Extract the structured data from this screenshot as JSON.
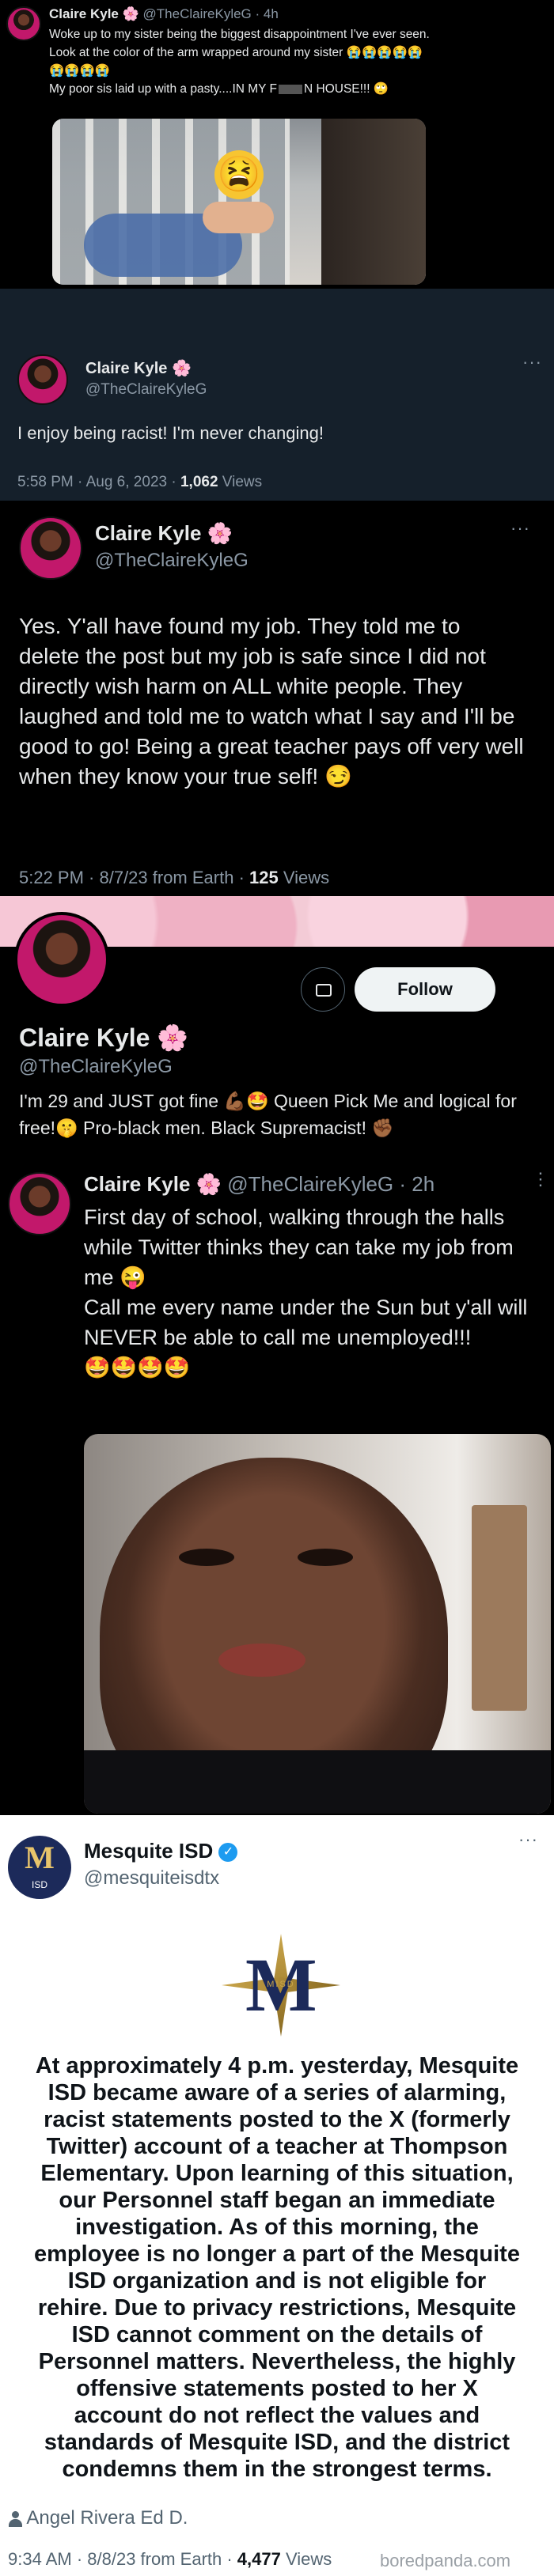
{
  "tweet1": {
    "name": "Claire Kyle",
    "name_emoji": "🌸",
    "handle": "@TheClaireKyleG",
    "time": "· 4h",
    "line1": "Woke up to my sister being the biggest disappointment I've ever seen.",
    "line2": "Look at the color of the arm wrapped around my sister",
    "line3_emojis": "😭😭😭😭😭",
    "line4_emojis": "😭😭😭😭",
    "line5": "My poor sis laid up with a pasty....IN MY F",
    "line5_end": "N HOUSE!!! 🙄",
    "photo_sticker": "😫"
  },
  "tweet2": {
    "name": "Claire Kyle",
    "name_emoji": "🌸",
    "handle": "@TheClaireKyleG",
    "text": "I enjoy being racist! I'm never changing!",
    "timestamp": "5:58 PM · Aug 6, 2023 · ",
    "views_count": "1,062",
    "views_label": " Views"
  },
  "tweet3": {
    "name": "Claire Kyle",
    "name_emoji": "🌸",
    "handle": "@TheClaireKyleG",
    "text": "Yes. Y'all have found my job. They told me to delete the post but my job is safe since I did not directly wish harm on ALL white people. They laughed and told me to watch what I say and I'll be good to go! Being a great teacher pays off very well when they know your true self! 😏",
    "timestamp": "5:22 PM · 8/7/23 from Earth · ",
    "views_count": "125",
    "views_label": " Views"
  },
  "profile": {
    "name": "Claire Kyle",
    "name_emoji": "🌸",
    "handle": "@TheClaireKyleG",
    "follow_label": "Follow",
    "bio": "I'm 29 and JUST got fine 💪🏾🤩 Queen Pick Me and logical for free!🤫 Pro-black men. Black Supremacist! ✊🏾"
  },
  "tweet4": {
    "name": "Claire Kyle",
    "name_emoji": "🌸",
    "handle": "@TheClaireKyleG",
    "time": "· 2h",
    "text1": "First day of school, walking through the halls while Twitter thinks they can take my job from me 😜",
    "text2": "Call me every name under the Sun but y'all will NEVER be able to call me unemployed!!!",
    "emojis": "🤩🤩🤩🤩"
  },
  "tweet5": {
    "name": "Mesquite ISD",
    "handle": "@mesquiteisdtx",
    "avatar_text": "M",
    "avatar_subtext": "ISD",
    "logo_text": "MISD",
    "text": "At approximately 4 p.m. yesterday, Mesquite ISD became aware of a series of alarming, racist statements posted to the X (formerly Twitter) account of a teacher at Thompson Elementary. Upon learning of this situation, our Personnel staff began an immediate investigation. As of this morning, the employee is no longer a part of the Mesquite ISD organization and is not eligible for rehire. Due to privacy restrictions, Mesquite ISD cannot comment on the details of Personnel matters. Nevertheless, the highly offensive statements posted to her X account do not reflect the values and standards of Mesquite ISD, and the district condemns them in the strongest terms.",
    "author": "Angel Rivera Ed D.",
    "timestamp": "9:34 AM · 8/8/23 from Earth · ",
    "views_count": "4,477",
    "views_label": " Views"
  },
  "watermark": "boredpanda.com"
}
